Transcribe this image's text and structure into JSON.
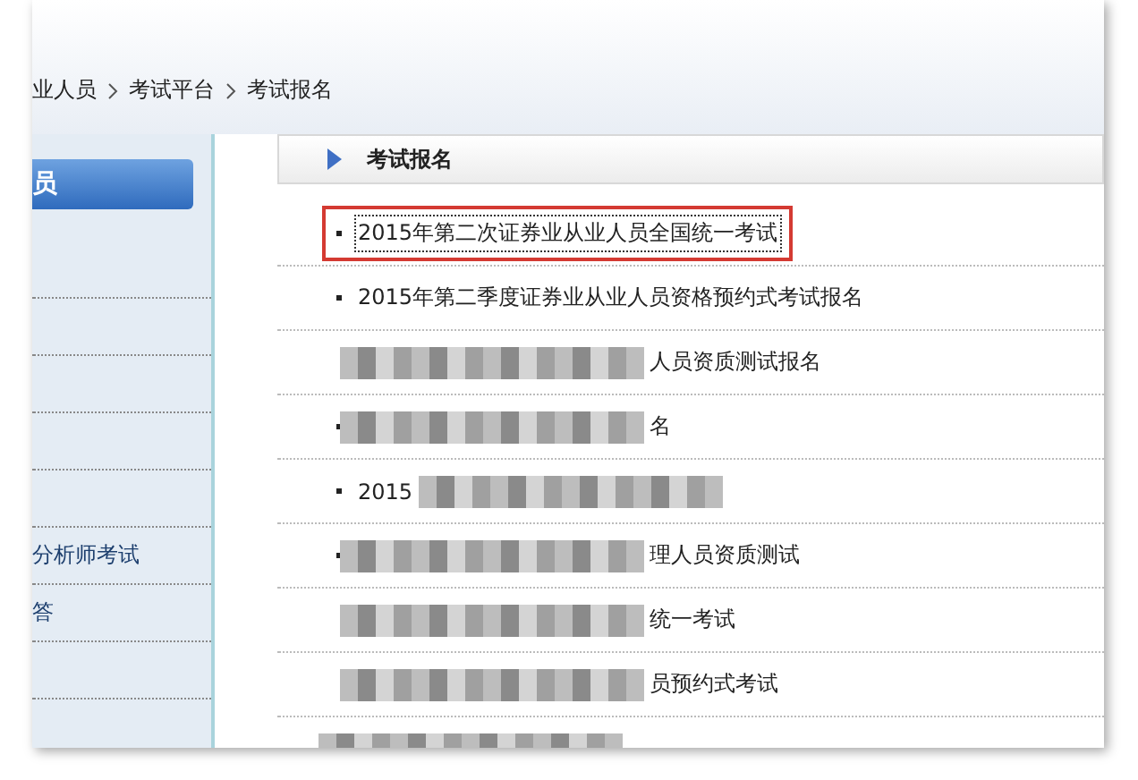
{
  "breadcrumb": [
    "业人员",
    "考试平台",
    "考试报名"
  ],
  "sidebar": {
    "button": "员",
    "items": [
      {
        "label": "分析师考试"
      },
      {
        "label": "答"
      }
    ]
  },
  "panel": {
    "title": "考试报名"
  },
  "items": [
    {
      "text": "2015年第二次证券业从业人员全国统一考试",
      "bullet": true,
      "blurred": false,
      "highlighted": true
    },
    {
      "text": "2015年第二季度证券业从业人员资格预约式考试报名",
      "bullet": true,
      "blurred": false,
      "highlighted": false
    },
    {
      "text": "人员资质测试报名",
      "bullet": false,
      "blurred": true,
      "highlighted": false
    },
    {
      "text": "名",
      "bullet": true,
      "blurred": true,
      "highlighted": false
    },
    {
      "text": "2015",
      "bullet": true,
      "blurred": true,
      "highlighted": false,
      "text_first": true
    },
    {
      "text": "理人员资质测试",
      "bullet": true,
      "blurred": true,
      "highlighted": false
    },
    {
      "text": "统一考试",
      "bullet": false,
      "blurred": true,
      "highlighted": false
    },
    {
      "text": "员预约式考试",
      "bullet": false,
      "blurred": true,
      "highlighted": false
    }
  ]
}
